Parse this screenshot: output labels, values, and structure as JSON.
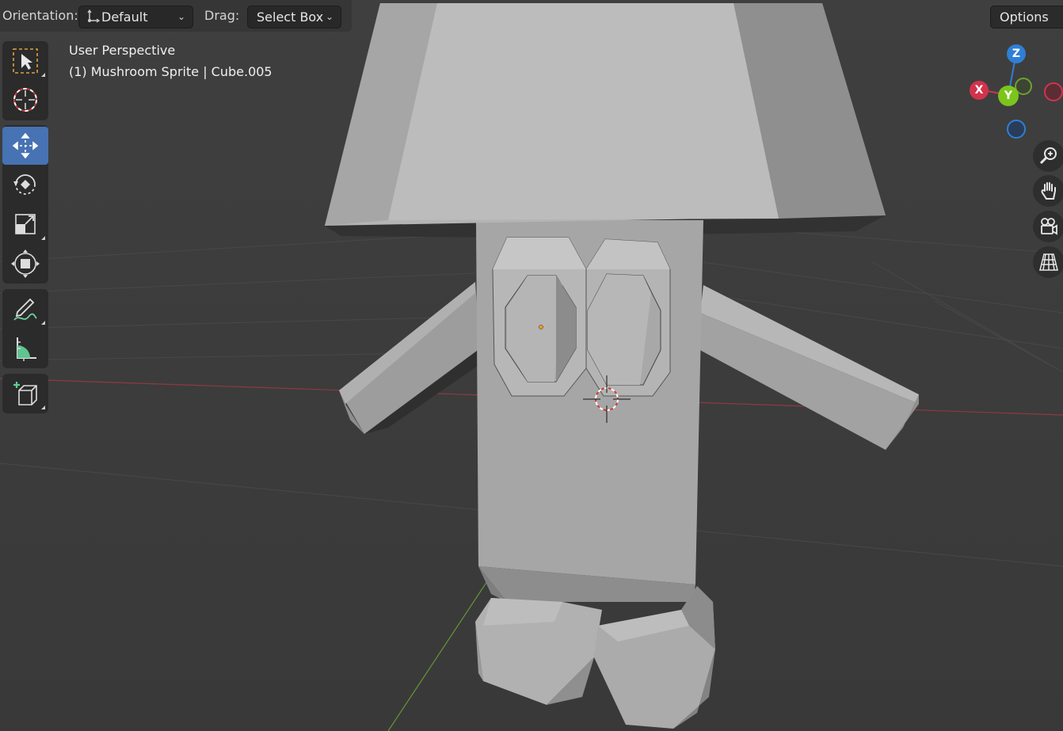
{
  "header": {
    "orientation_label": "Orientation:",
    "orientation_value": "Default",
    "drag_label": "Drag:",
    "drag_value": "Select Box",
    "options_label": "Options"
  },
  "viewport": {
    "view_name": "User Perspective",
    "object_info": "(1) Mushroom Sprite | Cube.005"
  },
  "toolbar": {
    "tools": [
      {
        "name": "Select Box",
        "icon": "select-box-icon",
        "active": false
      },
      {
        "name": "Cursor",
        "icon": "cursor-icon",
        "active": false
      },
      {
        "name": "Move",
        "icon": "move-icon",
        "active": true
      },
      {
        "name": "Rotate",
        "icon": "rotate-icon",
        "active": false
      },
      {
        "name": "Scale",
        "icon": "scale-icon",
        "active": false
      },
      {
        "name": "Transform",
        "icon": "transform-icon",
        "active": false
      },
      {
        "name": "Annotate",
        "icon": "annotate-icon",
        "active": false
      },
      {
        "name": "Measure",
        "icon": "measure-icon",
        "active": false
      },
      {
        "name": "Add Cube",
        "icon": "add-cube-icon",
        "active": false
      }
    ]
  },
  "gizmo": {
    "x_label": "X",
    "y_label": "Y",
    "z_label": "Z",
    "x_color": "#d2334c",
    "y_color": "#7cc51c",
    "z_color": "#2f7fd6"
  },
  "nav_buttons": [
    "zoom-icon",
    "pan-hand-icon",
    "camera-icon",
    "perspective-grid-icon"
  ],
  "colors": {
    "background": "#3d3d3d",
    "accent": "#4772b3",
    "x_axis_line": "#9a3a42",
    "y_axis_line": "#6f9a34"
  }
}
